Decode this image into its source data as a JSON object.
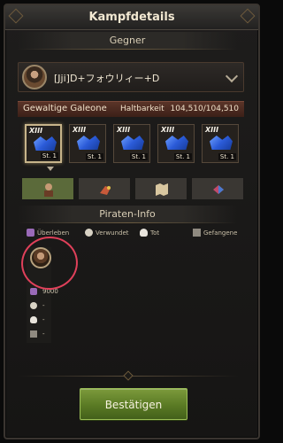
{
  "window": {
    "title": "Kampfdetails"
  },
  "sections": {
    "opponent_header": "Gegner",
    "pirate_info_header": "Piraten-Info"
  },
  "opponent": {
    "name": "[Jji]D+フォウリィー+D",
    "avatar_icon": "captain-portrait-icon",
    "dropdown_icon": "chevron-down-icon"
  },
  "ship": {
    "name": "Gewaltige Galeone",
    "durability_label": "Haltbarkeit",
    "durability_value": "104,510/104,510",
    "bar_color": "#5a3428"
  },
  "ships": [
    {
      "rank": "XIII",
      "level": "St. 1",
      "selected": true
    },
    {
      "rank": "XIII",
      "level": "St. 1",
      "selected": false
    },
    {
      "rank": "XIII",
      "level": "St. 1",
      "selected": false
    },
    {
      "rank": "XIII",
      "level": "St. 1",
      "selected": false
    },
    {
      "rank": "XIII",
      "level": "St. 1",
      "selected": false
    }
  ],
  "tabs": [
    {
      "icon": "pirate-crew-icon",
      "active": true
    },
    {
      "icon": "parrot-icon",
      "active": false
    },
    {
      "icon": "treasure-map-icon",
      "active": false
    },
    {
      "icon": "cargo-icon",
      "active": false
    }
  ],
  "stats_legend": [
    {
      "icon": "survived-icon",
      "label": "Überleben"
    },
    {
      "icon": "wounded-icon",
      "label": "Verwundet"
    },
    {
      "icon": "dead-icon",
      "label": "Tot"
    },
    {
      "icon": "captured-icon",
      "label": "Gefangene"
    }
  ],
  "pirate_stats": {
    "survived": "9000",
    "wounded": "-",
    "dead": "-",
    "captured": "-"
  },
  "confirm_button": {
    "label": "Bestätigen",
    "color": "#5a7a24"
  },
  "annotation": {
    "circle_color": "#e0405a"
  }
}
